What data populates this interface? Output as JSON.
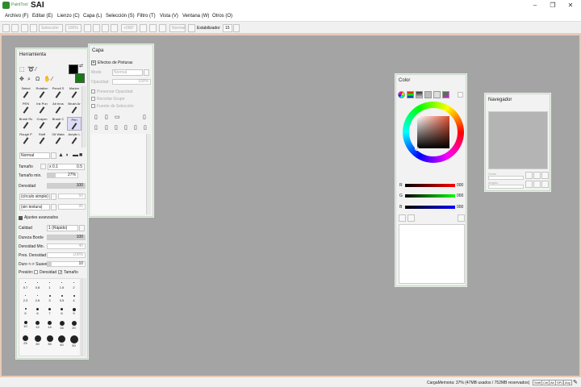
{
  "app": {
    "brand_sub": "PaintTool",
    "brand": "SAI"
  },
  "window_controls": {
    "minimize": "–",
    "maximize": "❐",
    "close": "✕"
  },
  "menu": [
    "Archivo (F)",
    "Editar (E)",
    "Lienzo (C)",
    "Capa (L)",
    "Selección (S)",
    "Filtro (T)",
    "Vista (V)",
    "Ventana (W)",
    "Otros (O)"
  ],
  "toolbar": {
    "selection": "Selección",
    "zoom": "100%",
    "angle": "+000°",
    "mode": "Normal",
    "stabilizer_label": "Estabilizador",
    "stabilizer_value": "15"
  },
  "status": {
    "memory": "CargaMemoria: 37% (47MB usados / 752MB reservados)",
    "keys": [
      "Shift",
      "Ctrl",
      "Alt",
      "SPC",
      "Any"
    ]
  },
  "tool_panel": {
    "title": "Herramienta",
    "tools": [
      {
        "name": "Select",
        "selected": false
      },
      {
        "name": "Rotation",
        "selected": false
      },
      {
        "name": "Pencil S",
        "selected": false
      },
      {
        "name": "Marker",
        "selected": false
      },
      {
        "name": "PEN",
        "selected": false
      },
      {
        "name": "Ink Pun",
        "selected": false
      },
      {
        "name": "Air brus",
        "selected": false
      },
      {
        "name": "Brush Ar",
        "selected": false
      },
      {
        "name": "Brush Rc",
        "selected": false
      },
      {
        "name": "Crayon",
        "selected": false
      },
      {
        "name": "Brush C",
        "selected": false
      },
      {
        "name": "Pen",
        "selected": true
      },
      {
        "name": "Rough P",
        "selected": false
      },
      {
        "name": "Stuff",
        "selected": false
      },
      {
        "name": "Oil Wata",
        "selected": false
      },
      {
        "name": "Acrylic L",
        "selected": false
      }
    ],
    "blend_mode": "Normal",
    "size_label": "Tamaño",
    "size_mult": "x 0.1",
    "size_value": "0.5",
    "min_size_label": "Tamaño min.",
    "min_size_value": "27%",
    "density_label": "Densidad",
    "density_value": "100",
    "shape": "(círculo simple)",
    "shape_value": "50",
    "texture": "(sin textura)",
    "texture_value": "95",
    "advanced_label": "Ajustes avanzados",
    "quality_label": "Calidad",
    "quality_value": "1 (Rápido)",
    "hardness_label": "Dureza Borde",
    "hardness_value": "100",
    "min_density_label": "Densidad Min.",
    "min_density_value": "40",
    "pressure_density_label": "Pres. Densidad I",
    "pressure_density_value": "100%",
    "hard_soft_label": "Duro <-> Suave",
    "hard_soft_value": "10",
    "pressure_label": "Presión:",
    "pressure_density": "Densidad",
    "pressure_size": "Tamaño",
    "brush_sizes": [
      "0.7",
      "0.8",
      "1",
      "1.5",
      "2",
      "2.3",
      "2.6",
      "3",
      "3.5",
      "4",
      "5",
      "6",
      "7",
      "8",
      "9",
      "10",
      "12",
      "14",
      "16",
      "20",
      "25",
      "30",
      "35",
      "40",
      "50"
    ]
  },
  "layer_panel": {
    "title": "Capa",
    "effects_label": "Efectos de Pinturas",
    "mode_label": "Modo",
    "mode_value": "Normal",
    "opacity_label": "Opacidad",
    "opacity_value": "100%",
    "preserve_opacity": "Preservar Opacidad",
    "clip_group": "Recortar Grupo",
    "selection_source": "Fuente de Selección"
  },
  "color_panel": {
    "title": "Color",
    "r_label": "R",
    "r_value": "000",
    "g_label": "G",
    "g_value": "000",
    "b_label": "B",
    "b_value": "000",
    "primary_color": "#000000",
    "secondary_color": "#1a7a1a"
  },
  "navigator_panel": {
    "title": "Navegador",
    "zoom_label": "Zoom",
    "angle_label": "Ángulo"
  }
}
